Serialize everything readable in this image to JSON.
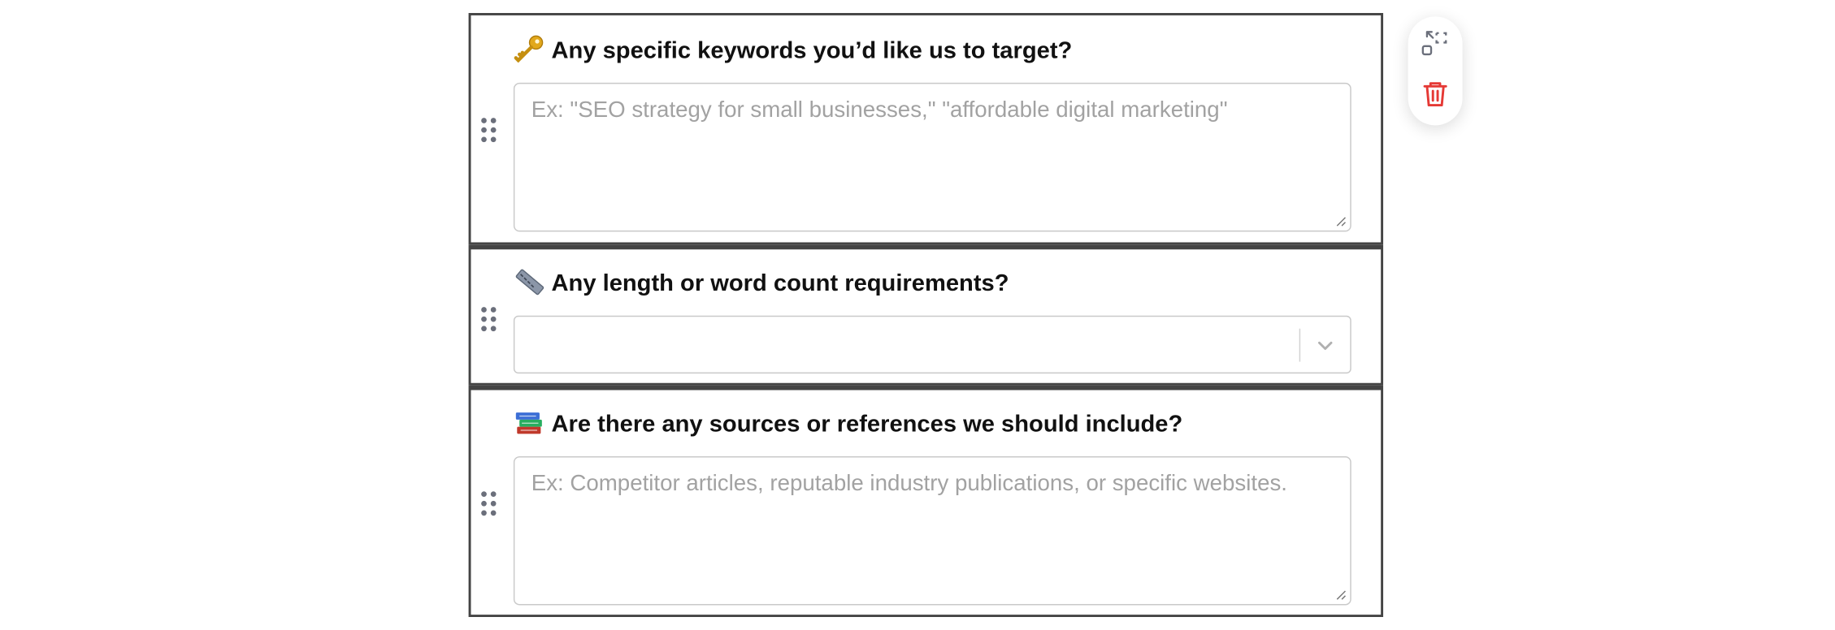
{
  "questions": [
    {
      "emoji_icon": "key-icon",
      "label": "Any specific keywords you’d like us to target?",
      "type": "textarea",
      "placeholder": "Ex: \"SEO strategy for small businesses,\" \"affordable digital marketing\""
    },
    {
      "emoji_icon": "ruler-icon",
      "label": "Any length or word count requirements?",
      "type": "select",
      "selected_value": ""
    },
    {
      "emoji_icon": "books-icon",
      "label": "Are there any sources or references we should include?",
      "type": "textarea",
      "placeholder": "Ex: Competitor articles, reputable industry publications, or specific websites."
    }
  ],
  "toolbar": {
    "actions": [
      "collapse-expand-icon",
      "trash-icon"
    ]
  },
  "colors": {
    "border": "#444444",
    "placeholder": "#a2a2a2",
    "delete": "#e53935"
  }
}
